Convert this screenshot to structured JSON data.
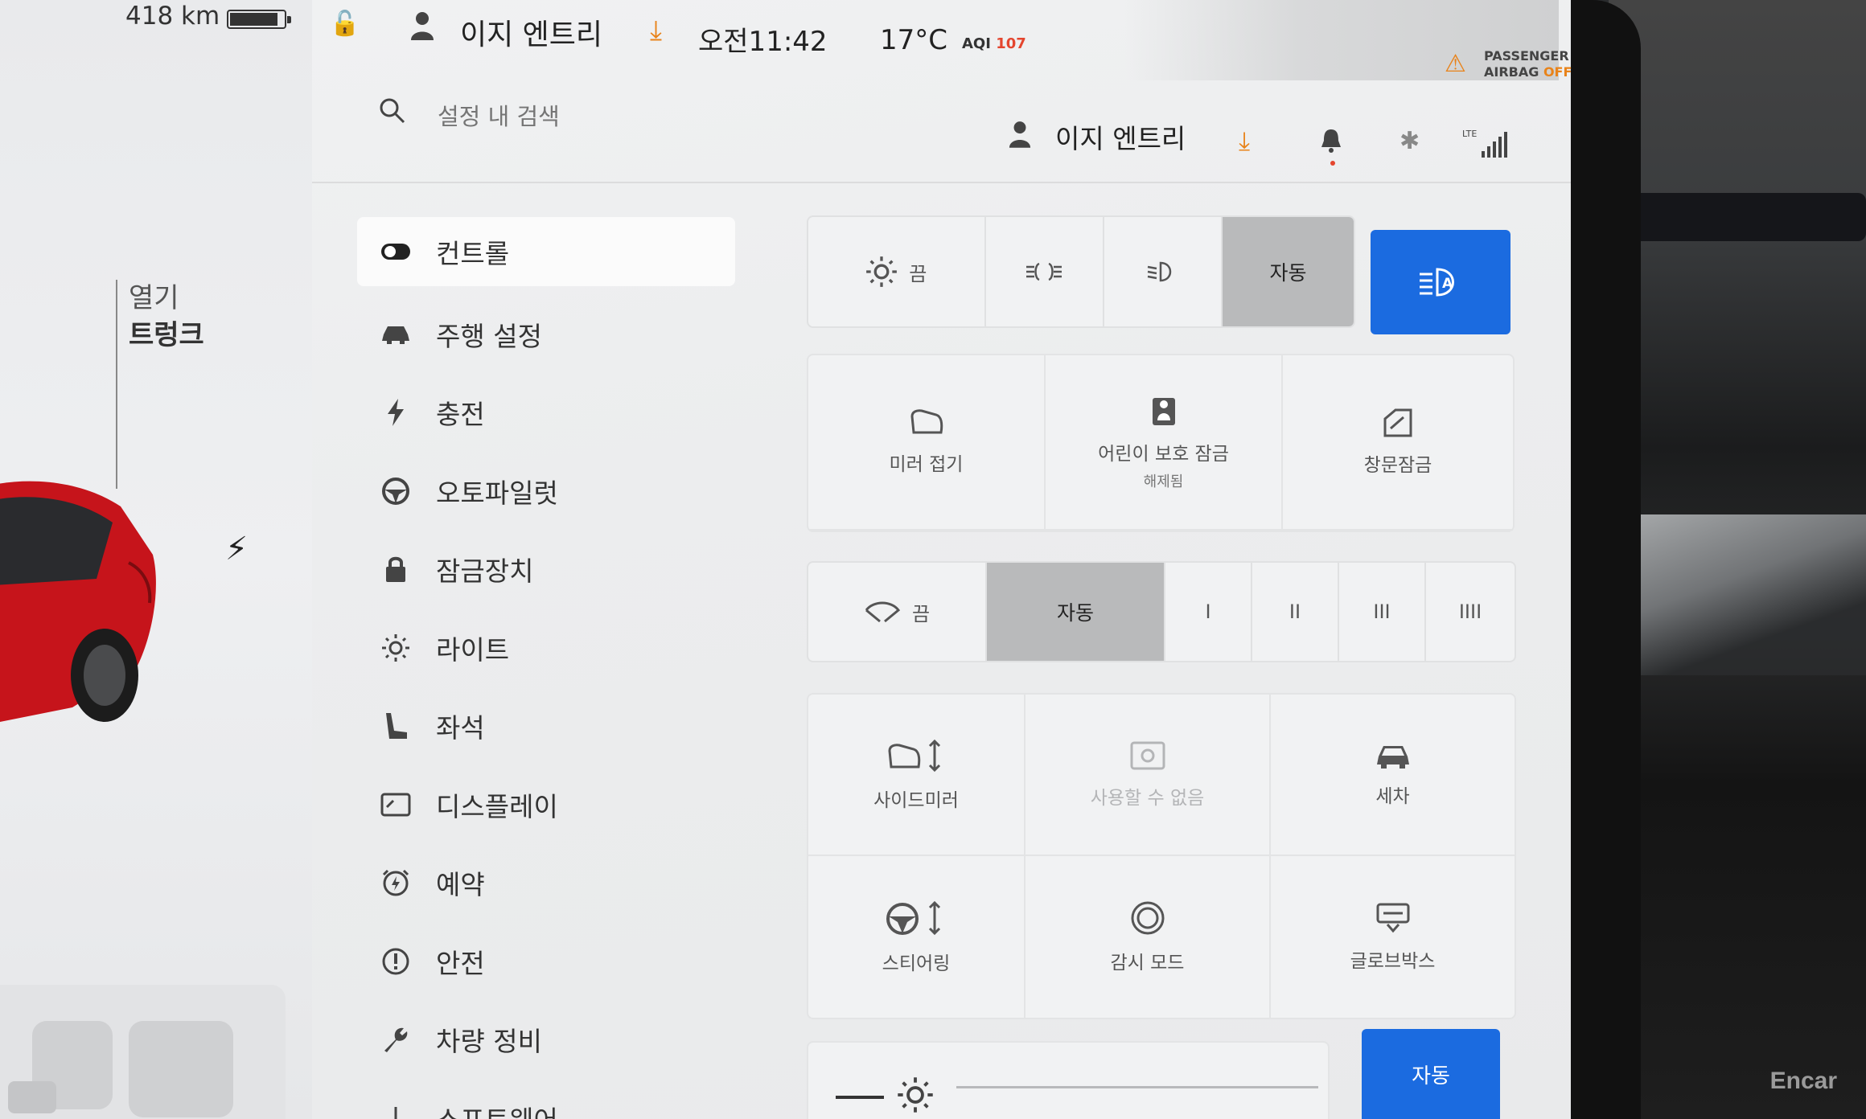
{
  "status": {
    "range": "418 km",
    "battery_level_pct": 90,
    "driver_profile": "이지 엔트리",
    "time": "오전11:42",
    "temperature": "17°C",
    "aqi_label": "AQI",
    "aqi_value": "107",
    "airbag_line1": "PASSENGER",
    "airbag_line2": "AIRBAG",
    "airbag_state": "OFF"
  },
  "car_panel": {
    "trunk_action": "열기",
    "trunk_label": "트렁크"
  },
  "header": {
    "search_placeholder": "설정 내 검색",
    "profile_name": "이지 엔트리",
    "lte_label": "LTE"
  },
  "nav": [
    {
      "label": "컨트롤",
      "icon": "toggle-icon",
      "active": true
    },
    {
      "label": "주행 설정",
      "icon": "car-icon"
    },
    {
      "label": "충전",
      "icon": "bolt-icon"
    },
    {
      "label": "오토파일럿",
      "icon": "steering-wheel-icon"
    },
    {
      "label": "잠금장치",
      "icon": "lock-icon"
    },
    {
      "label": "라이트",
      "icon": "sun-icon"
    },
    {
      "label": "좌석",
      "icon": "seat-icon"
    },
    {
      "label": "디스플레이",
      "icon": "display-icon"
    },
    {
      "label": "예약",
      "icon": "schedule-icon"
    },
    {
      "label": "안전",
      "icon": "alert-icon"
    },
    {
      "label": "차량 정비",
      "icon": "wrench-icon"
    },
    {
      "label": "소프트웨어",
      "icon": "download-icon"
    }
  ],
  "lights": {
    "off_label": "끔",
    "auto_label": "자동",
    "selected": "자동"
  },
  "quick_controls": {
    "mirror_fold": "미러 접기",
    "child_lock": "어린이 보호 잠금",
    "child_lock_state": "해제됨",
    "window_lock": "창문잠금"
  },
  "wipers": {
    "off_label": "끔",
    "auto_label": "자동",
    "speeds": [
      "I",
      "II",
      "III",
      "IIII"
    ],
    "selected": "자동"
  },
  "adjust_tiles": {
    "side_mirror": "사이드미러",
    "unavailable": "사용할 수 없음",
    "car_wash": "세차",
    "steering": "스티어링",
    "sentry_mode": "감시 모드",
    "glovebox": "글로브박스"
  },
  "brightness": {
    "auto_label": "자동"
  },
  "watermark": "Encar",
  "colors": {
    "accent_blue": "#1b6be0",
    "download_orange": "#e8831a",
    "aqi_red": "#e4452e",
    "selected_gray": "#b9babb"
  }
}
